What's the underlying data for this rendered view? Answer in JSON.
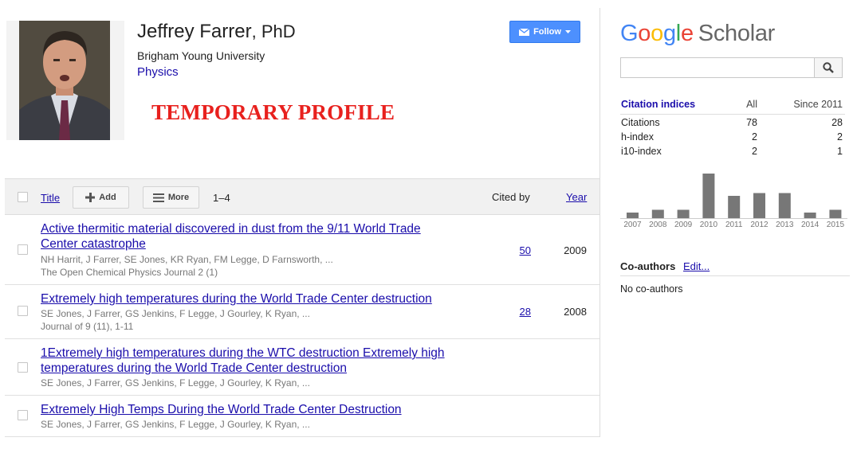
{
  "profile": {
    "name": "Jeffrey Farrer",
    "name_suffix": ", PhD",
    "affiliation": "Brigham Young University",
    "field": "Physics",
    "banner": "TEMPORARY PROFILE",
    "follow_label": "Follow"
  },
  "table": {
    "header": {
      "title_label": "Title",
      "add_label": "Add",
      "more_label": "More",
      "range": "1–4",
      "cited_by_label": "Cited by",
      "year_label": "Year"
    },
    "rows": [
      {
        "title": "Active thermitic material discovered in dust from the 9/11 World Trade Center catastrophe",
        "authors": "NH Harrit, J Farrer, SE Jones, KR Ryan, FM Legge, D Farnsworth, ...",
        "venue": "The Open Chemical Physics Journal 2 (1)",
        "cited_by": "50",
        "year": "2009"
      },
      {
        "title": "Extremely high temperatures during the World Trade Center destruction",
        "authors": "SE Jones, J Farrer, GS Jenkins, F Legge, J Gourley, K Ryan, ...",
        "venue": "Journal of 9 (11), 1-11",
        "cited_by": "28",
        "year": "2008"
      },
      {
        "title": "1Extremely high temperatures during the WTC destruction Extremely high temperatures during the World Trade Center destruction",
        "authors": "SE Jones, J Farrer, GS Jenkins, F Legge, J Gourley, K Ryan, ...",
        "venue": "",
        "cited_by": "",
        "year": ""
      },
      {
        "title": "Extremely High Temps During the World Trade Center Destruction",
        "authors": "SE Jones, J Farrer, GS Jenkins, F Legge, J Gourley, K Ryan, ...",
        "venue": "",
        "cited_by": "",
        "year": ""
      }
    ]
  },
  "sidebar": {
    "logo_google": "Google",
    "logo_scholar": "Scholar",
    "search_value": "",
    "citation_indices": {
      "header": [
        "Citation indices",
        "All",
        "Since 2011"
      ],
      "rows": [
        [
          "Citations",
          "78",
          "28"
        ],
        [
          "h-index",
          "2",
          "2"
        ],
        [
          "i10-index",
          "2",
          "1"
        ]
      ]
    },
    "coauthors_label": "Co-authors",
    "coauthors_edit": "Edit...",
    "coauthors_empty": "No co-authors"
  },
  "chart_data": {
    "type": "bar",
    "categories": [
      "2007",
      "2008",
      "2009",
      "2010",
      "2011",
      "2012",
      "2013",
      "2014",
      "2015"
    ],
    "values": [
      2,
      3,
      3,
      16,
      8,
      9,
      9,
      2,
      3
    ],
    "title": "",
    "xlabel": "",
    "ylabel": "",
    "ylim": [
      0,
      16
    ],
    "bar_color": "#777777"
  },
  "colors": {
    "link": "#1a0dab",
    "banner": "#e8211e",
    "follow_button": "#4d90fe"
  }
}
